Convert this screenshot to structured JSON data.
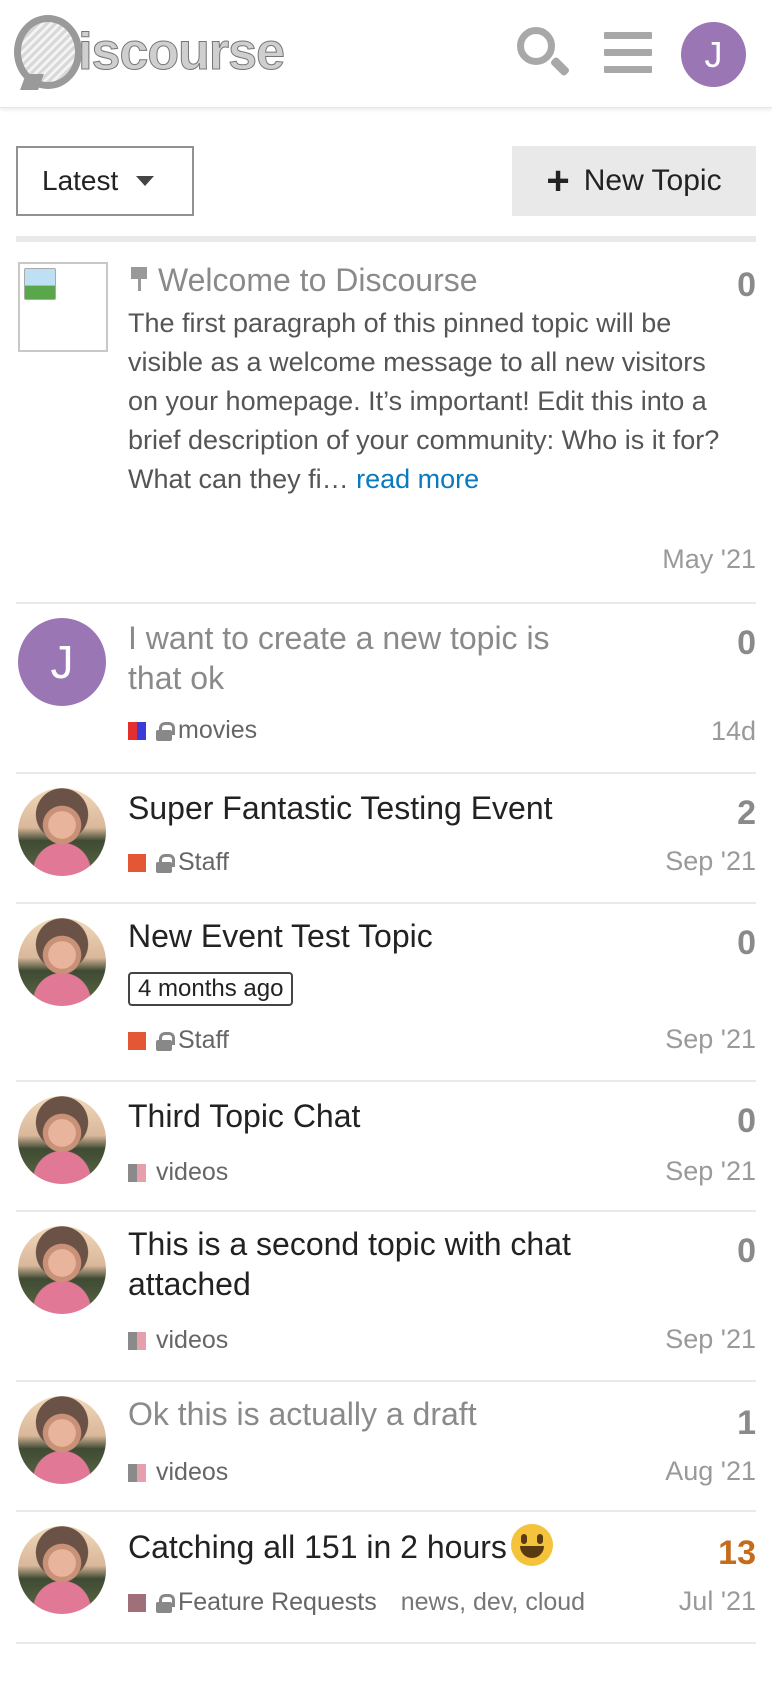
{
  "header": {
    "logo_text": "iscourse",
    "logo_full": "Discourse",
    "user_initial": "J"
  },
  "nav": {
    "filter_label": "Latest",
    "new_topic_label": "New Topic"
  },
  "colors": {
    "accent_link": "#0a7ac0",
    "hot_count": "#c56b1c",
    "avatar_purple": "#9b76b5",
    "staff_category": "#e45735",
    "videos_category": "#b8868f",
    "feature_requests_category": "#a0707a"
  },
  "topics": [
    {
      "title": "Welcome to Discourse",
      "excerpt": "The first paragraph of this pinned topic will be visible as a welcome message to all new visitors on your homepage. It’s important! Edit this into a brief description of your community: Who is it for? What can they fi…",
      "read_more": "read more",
      "replies": "0",
      "age": "May '21",
      "pinned": true
    },
    {
      "title": "I want to create a new topic is that ok",
      "category": "movies",
      "replies": "0",
      "age": "14d",
      "avatar_initial": "J"
    },
    {
      "title": "Super Fantastic Testing Event",
      "category": "Staff",
      "replies": "2",
      "age": "Sep '21"
    },
    {
      "title": "New Event Test Topic",
      "badge": "4 months ago",
      "category": "Staff",
      "replies": "0",
      "age": "Sep '21"
    },
    {
      "title": "Third Topic Chat",
      "category": "videos",
      "replies": "0",
      "age": "Sep '21"
    },
    {
      "title": "This is a second topic with chat attached",
      "category": "videos",
      "replies": "0",
      "age": "Sep '21"
    },
    {
      "title": "Ok this is actually a draft",
      "category": "videos",
      "replies": "1",
      "age": "Aug '21"
    },
    {
      "title": "Catching all 151 in 2 hours",
      "category": "Feature Requests",
      "tags": "news, dev, cloud",
      "replies": "13",
      "age": "Jul '21",
      "emoji": "grinning-face-icon"
    }
  ]
}
